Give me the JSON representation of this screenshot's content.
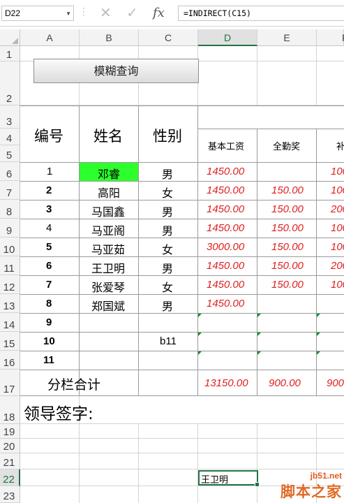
{
  "formula_bar": {
    "name_box": "D22",
    "formula": "=INDIRECT(C15)",
    "cancel_icon": "close-icon",
    "confirm_icon": "check-icon",
    "fx_label": "fx"
  },
  "columns": [
    "A",
    "B",
    "C",
    "D",
    "E",
    "F"
  ],
  "rows": [
    "1",
    "2",
    "3",
    "4",
    "5",
    "6",
    "7",
    "8",
    "9",
    "10",
    "11",
    "12",
    "13",
    "14",
    "15",
    "16",
    "17",
    "18",
    "19",
    "20",
    "21",
    "22",
    "23"
  ],
  "active_cell": "D22",
  "button": {
    "label": "模糊查询"
  },
  "headers": {
    "number": "编号",
    "name": "姓名",
    "gender": "性别",
    "base_salary": "基本工资",
    "attendance_bonus": "全勤奖",
    "allowance_partial": "补"
  },
  "records": [
    {
      "no": "1",
      "name": "邓睿",
      "gender": "男",
      "base": "1450.00",
      "bonus": "",
      "allow": "100"
    },
    {
      "no": "2",
      "name": "高阳",
      "gender": "女",
      "base": "1450.00",
      "bonus": "150.00",
      "allow": "100"
    },
    {
      "no": "3",
      "name": "马国鑫",
      "gender": "男",
      "base": "1450.00",
      "bonus": "150.00",
      "allow": "200"
    },
    {
      "no": "4",
      "name": "马亚阁",
      "gender": "男",
      "base": "1450.00",
      "bonus": "150.00",
      "allow": "100"
    },
    {
      "no": "5",
      "name": "马亚茹",
      "gender": "女",
      "base": "3000.00",
      "bonus": "150.00",
      "allow": "100"
    },
    {
      "no": "6",
      "name": "王卫明",
      "gender": "男",
      "base": "1450.00",
      "bonus": "150.00",
      "allow": "200"
    },
    {
      "no": "7",
      "name": "张爱琴",
      "gender": "女",
      "base": "1450.00",
      "bonus": "150.00",
      "allow": "100"
    },
    {
      "no": "8",
      "name": "郑国斌",
      "gender": "男",
      "base": "1450.00",
      "bonus": "",
      "allow": ""
    },
    {
      "no": "9",
      "name": "",
      "gender": "",
      "base": "",
      "bonus": "",
      "allow": ""
    },
    {
      "no": "10",
      "name": "",
      "gender": "b11",
      "base": "",
      "bonus": "",
      "allow": ""
    },
    {
      "no": "11",
      "name": "",
      "gender": "",
      "base": "",
      "bonus": "",
      "allow": ""
    }
  ],
  "totals": {
    "label": "分栏合计",
    "base": "13150.00",
    "bonus": "900.00",
    "allow": "900"
  },
  "signature_label": "领导签字:",
  "active_cell_value": "王卫明",
  "colors": {
    "highlight": "#2dff2d",
    "red_text": "#e02020",
    "excel_green": "#217346"
  },
  "watermark": {
    "url": "jb51.net",
    "text": "脚本之家"
  }
}
